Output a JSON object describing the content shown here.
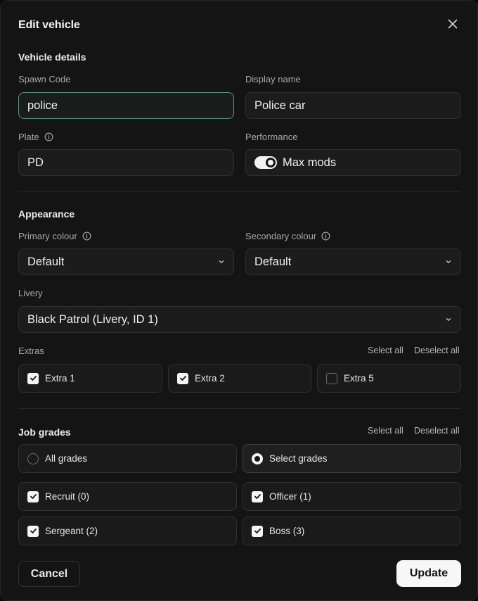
{
  "dialog": {
    "title": "Edit vehicle",
    "close_icon": "close-icon"
  },
  "vehicle_details": {
    "heading": "Vehicle details",
    "spawn_code": {
      "label": "Spawn Code",
      "value": "police"
    },
    "display_name": {
      "label": "Display name",
      "value": "Police car"
    },
    "plate": {
      "label": "Plate",
      "value": "PD",
      "info_icon": "info-icon"
    },
    "performance": {
      "label": "Performance",
      "toggle_label": "Max mods",
      "toggle_on": true
    }
  },
  "appearance": {
    "heading": "Appearance",
    "primary_colour": {
      "label": "Primary colour",
      "value": "Default",
      "info_icon": "info-icon"
    },
    "secondary_colour": {
      "label": "Secondary colour",
      "value": "Default",
      "info_icon": "info-icon"
    },
    "livery": {
      "label": "Livery",
      "value": "Black Patrol (Livery, ID 1)"
    },
    "extras": {
      "label": "Extras",
      "select_all": "Select all",
      "deselect_all": "Deselect all",
      "items": [
        {
          "label": "Extra 1",
          "checked": true
        },
        {
          "label": "Extra 2",
          "checked": true
        },
        {
          "label": "Extra 5",
          "checked": false
        }
      ]
    }
  },
  "job_grades": {
    "heading": "Job grades",
    "select_all": "Select all",
    "deselect_all": "Deselect all",
    "modes": [
      {
        "label": "All grades",
        "selected": false
      },
      {
        "label": "Select grades",
        "selected": true
      }
    ],
    "grades": [
      {
        "label": "Recruit (0)",
        "checked": true
      },
      {
        "label": "Officer (1)",
        "checked": true
      },
      {
        "label": "Sergeant (2)",
        "checked": true
      },
      {
        "label": "Boss (3)",
        "checked": true
      }
    ]
  },
  "footer": {
    "cancel_label": "Cancel",
    "update_label": "Update"
  },
  "colors": {
    "dialog_bg": "#141414",
    "field_bg": "#1c1c1c",
    "focus_border": "#5e9484",
    "primary_button_bg": "#f7f7f7"
  }
}
